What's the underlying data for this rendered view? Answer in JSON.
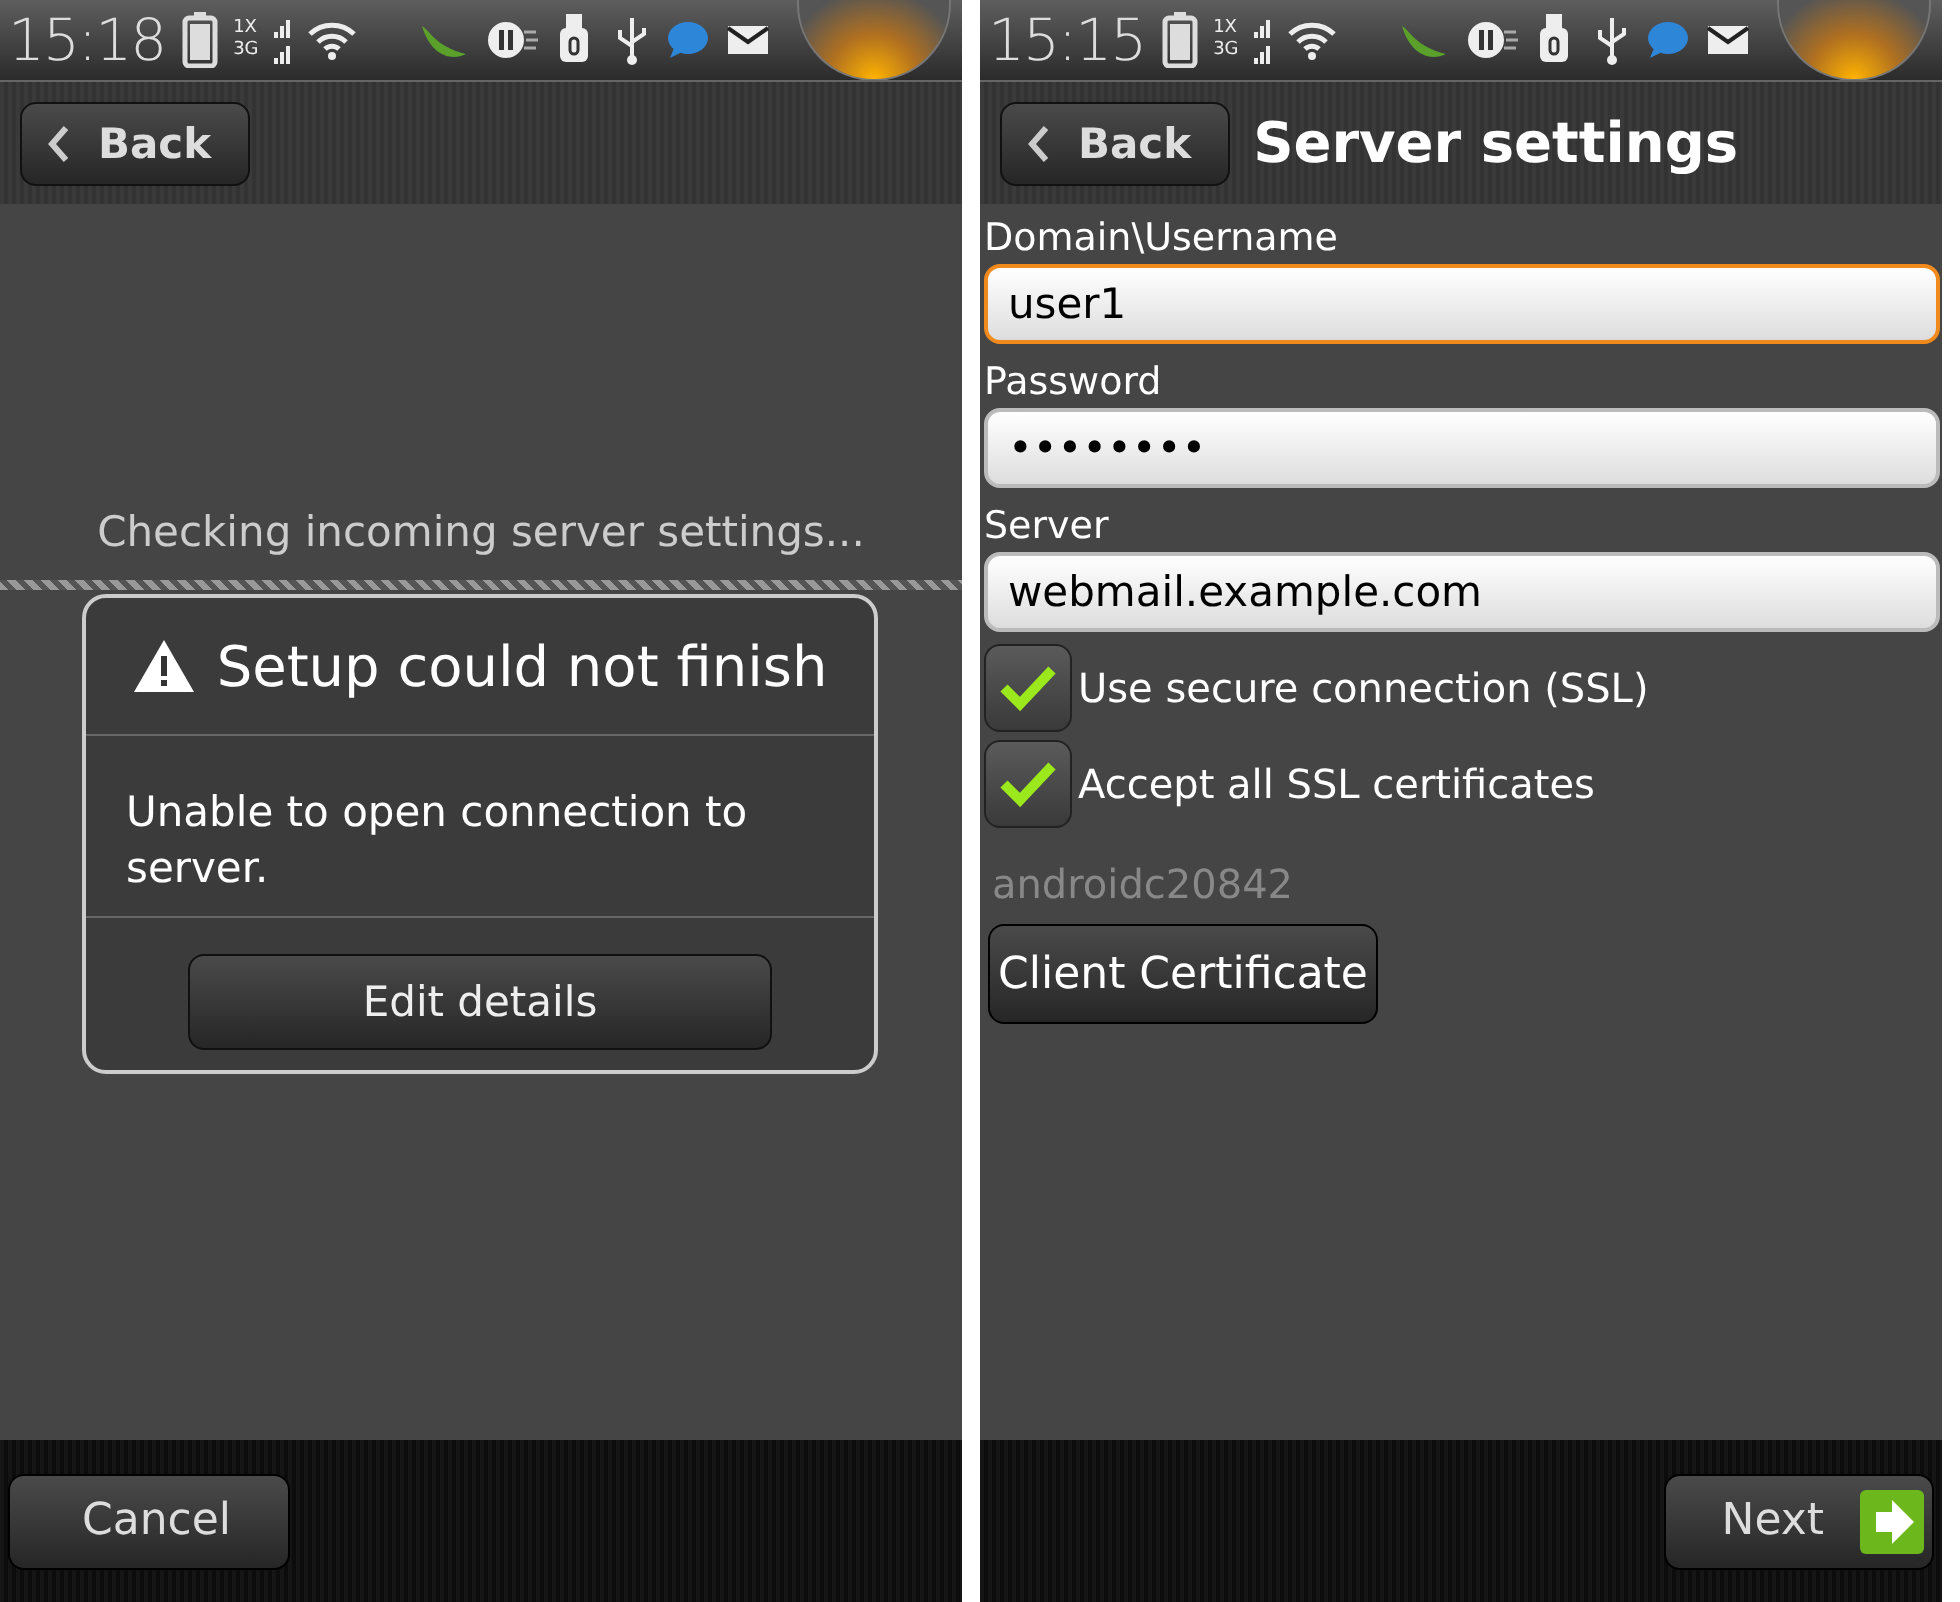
{
  "screens": [
    {
      "kind": "error_dialog",
      "status_bar": {
        "time": "15:18",
        "network_labels": [
          "1X",
          "3G"
        ]
      },
      "back_button": "Back",
      "progress_text": "Checking incoming server settings...",
      "dialog": {
        "title": "Setup could not finish",
        "message": "Unable to open connection to server.",
        "button": "Edit details"
      },
      "bottom_button": {
        "label": "Cancel",
        "kind": "cancel"
      }
    },
    {
      "kind": "server_settings",
      "status_bar": {
        "time": "15:15",
        "network_labels": [
          "1X",
          "3G"
        ]
      },
      "back_button": "Back",
      "title": "Server settings",
      "fields": [
        {
          "label": "Domain\\Username",
          "value": "user1",
          "focused": true
        },
        {
          "label": "Password",
          "value": "••••••••",
          "focused": false
        },
        {
          "label": "Server",
          "value": "webmail.example.com",
          "focused": false
        }
      ],
      "checkboxes": [
        {
          "label": "Use secure connection (SSL)",
          "checked": true
        },
        {
          "label": "Accept all SSL certificates",
          "checked": true
        }
      ],
      "certificate_alias": "androidc20842",
      "certificate_button": "Client Certificate",
      "bottom_button": {
        "label": "Next",
        "kind": "next"
      }
    }
  ]
}
